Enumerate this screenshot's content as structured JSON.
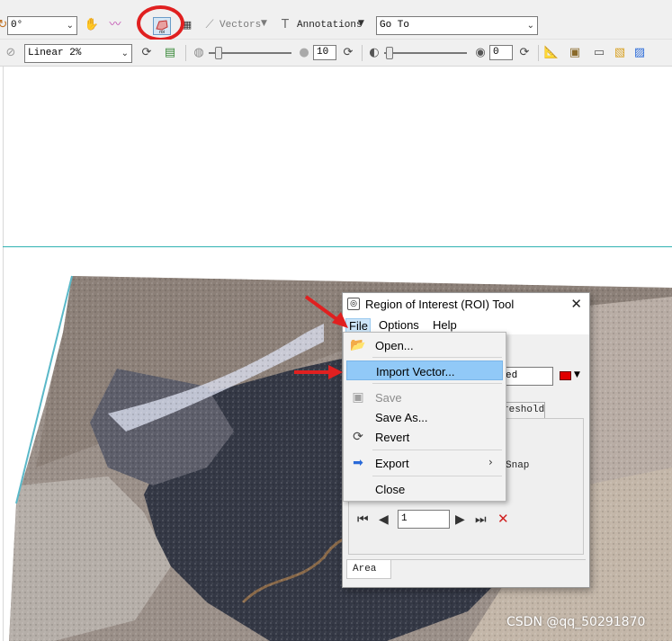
{
  "toolbar1": {
    "rotation_value": "0°",
    "vectors_label": "Vectors",
    "annotations_label": "Annotations",
    "goto_value": "Go To",
    "roi_icon_text": "roi"
  },
  "toolbar2": {
    "stretch_value": "Linear 2%",
    "brightness_value": "10",
    "transparency_value": "0"
  },
  "roi_window": {
    "title": "Region of Interest (ROI) Tool",
    "menus": [
      "File",
      "Options",
      "Help"
    ],
    "name_field_partial": "ed",
    "tab_partial": "reshold",
    "snap_partial": "Snap",
    "nav_value": "1",
    "bottom_tab": "Area",
    "roi_color": "#e00000"
  },
  "file_menu": {
    "items": [
      {
        "label": "Open...",
        "icon": "folder-open-icon",
        "disabled": false
      },
      {
        "label": "Import Vector...",
        "icon": "",
        "disabled": false,
        "highlighted": true
      },
      {
        "label": "Save",
        "icon": "save-icon",
        "disabled": true
      },
      {
        "label": "Save As...",
        "icon": "",
        "disabled": false
      },
      {
        "label": "Revert",
        "icon": "revert-icon",
        "disabled": false
      },
      {
        "label": "Export",
        "icon": "export-icon",
        "disabled": false,
        "submenu": true
      },
      {
        "label": "Close",
        "icon": "",
        "disabled": false
      }
    ]
  },
  "watermark": "CSDN @qq_50291870",
  "colors": {
    "highlight_circle": "#e02020",
    "annotation_arrow": "#e02020",
    "guide_line": "#2fb2b2",
    "menu_highlight": "#91c9f7"
  }
}
